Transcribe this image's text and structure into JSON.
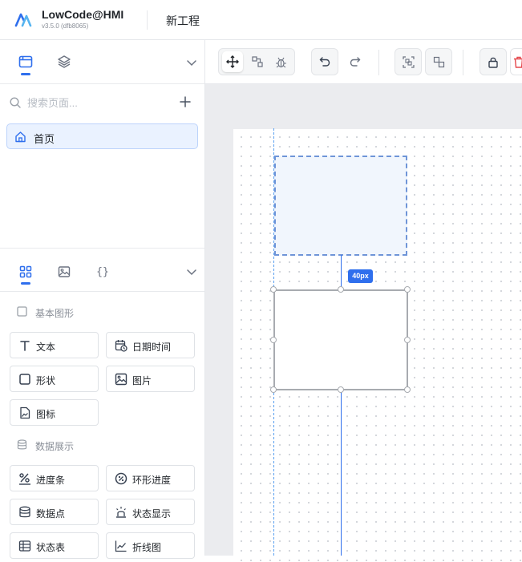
{
  "header": {
    "app_name": "LowCode@HMI",
    "version": "v3.5.0 (dfb8065)",
    "project_name": "新工程",
    "logo_icon": "lowcode-logo"
  },
  "colors": {
    "accent": "#2f6fed",
    "selected_bg": "#eaf2ff",
    "canvas_bg": "#ebecef",
    "danger": "#e5484d"
  },
  "sidebar": {
    "top_tabs": [
      {
        "icon": "browser-window-icon",
        "active": true
      },
      {
        "icon": "layers-icon",
        "active": false
      }
    ],
    "search_placeholder": "搜索页面...",
    "pages": [
      {
        "label": "首页",
        "icon": "home-icon",
        "selected": true
      }
    ],
    "bottom_tabs": [
      {
        "icon": "components-grid-icon",
        "active": true
      },
      {
        "icon": "image-icon",
        "active": false
      },
      {
        "label": "{}",
        "icon": "braces-icon",
        "active": false
      }
    ],
    "sections": [
      {
        "title": "基本图形",
        "items": [
          {
            "label": "文本",
            "icon": "text-icon"
          },
          {
            "label": "日期时间",
            "icon": "calendar-clock-icon"
          },
          {
            "label": "形状",
            "icon": "square-icon"
          },
          {
            "label": "图片",
            "icon": "image-icon"
          },
          {
            "label": "图标",
            "icon": "file-image-icon"
          }
        ]
      },
      {
        "title": "数据展示",
        "items": [
          {
            "label": "进度条",
            "icon": "percent-icon"
          },
          {
            "label": "环形进度",
            "icon": "ring-percent-icon"
          },
          {
            "label": "数据点",
            "icon": "database-icon"
          },
          {
            "label": "状态显示",
            "icon": "alarm-light-icon"
          },
          {
            "label": "状态表",
            "icon": "table-icon"
          },
          {
            "label": "折线图",
            "icon": "line-chart-icon"
          }
        ]
      }
    ]
  },
  "toolbar": {
    "buttons": [
      {
        "name": "move-tool",
        "icon": "move-icon",
        "active": true
      },
      {
        "name": "connect-tool",
        "icon": "connect-nodes-icon",
        "active": false
      },
      {
        "name": "debug-tool",
        "icon": "bug-icon",
        "active": false
      },
      {
        "name": "undo",
        "icon": "undo-icon"
      },
      {
        "name": "redo",
        "icon": "redo-icon"
      },
      {
        "name": "group",
        "icon": "group-icon"
      },
      {
        "name": "ungroup",
        "icon": "ungroup-icon"
      },
      {
        "name": "lock",
        "icon": "lock-icon"
      },
      {
        "name": "delete",
        "icon": "trash-icon"
      }
    ]
  },
  "canvas": {
    "distance_label": "40px"
  }
}
